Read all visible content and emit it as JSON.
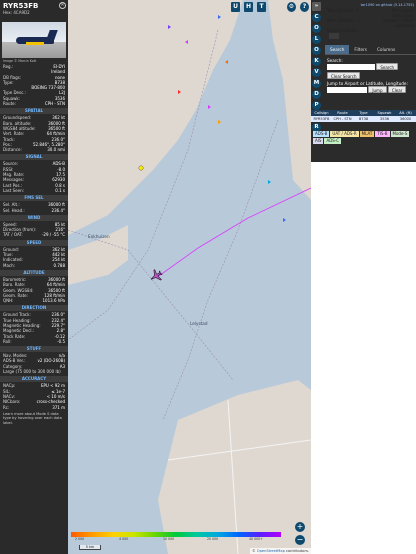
{
  "aircraft": {
    "callsign": "RYR53FB",
    "hex_line": "Hex: 4CA9D2",
    "photo_credit": "Image © Marcin Kott",
    "details": [
      {
        "k": "Reg.:",
        "v": "EI-DYI"
      },
      {
        "k": "",
        "v": "Ireland"
      },
      {
        "k": "DB flags:",
        "v": "none"
      },
      {
        "k": "Type:",
        "v": "B738"
      },
      {
        "k": "",
        "v": "BOEING 737-800"
      },
      {
        "k": "Type Desc.:",
        "v": "L2J"
      },
      {
        "k": "Squawk:",
        "v": "3536"
      },
      {
        "k": "Route:",
        "v": "CPH - STN"
      }
    ],
    "sections": [
      {
        "title": "SPATIAL",
        "rows": [
          {
            "k": "Groundspeed:",
            "v": "362 kt"
          },
          {
            "k": "Baro. altitude:",
            "v": "36000 ft"
          },
          {
            "k": "WGS84 altitude:",
            "v": "36500 ft"
          },
          {
            "k": "Vert. Rate:",
            "v": "64 ft/min"
          },
          {
            "k": "Track:",
            "v": "236.0°"
          },
          {
            "k": "Pos.:",
            "v": "52.846°, 5.280°"
          },
          {
            "k": "Distance:",
            "v": "30.0 nmi"
          }
        ]
      },
      {
        "title": "SIGNAL",
        "rows": [
          {
            "k": "Source:",
            "v": "ADS-B"
          },
          {
            "k": "RSSI:",
            "v": "-8.0"
          },
          {
            "k": "Msg. Rate:",
            "v": "17.5"
          },
          {
            "k": "Messages:",
            "v": "62930"
          },
          {
            "k": "Last Pos.:",
            "v": "0.8 s"
          },
          {
            "k": "Last Seen:",
            "v": "0.1 s"
          }
        ]
      },
      {
        "title": "FMS SEL",
        "rows": [
          {
            "k": "Sel. Alt.:",
            "v": "36000 ft"
          },
          {
            "k": "Sel. Head.:",
            "v": "236.4°"
          }
        ]
      },
      {
        "title": "WIND",
        "rows": [
          {
            "k": "Speed:",
            "v": "85 kt"
          },
          {
            "k": "Direction (from):",
            "v": "216°"
          },
          {
            "k": "TAT / OAT:",
            "v": "-29 / -55 °C"
          }
        ]
      },
      {
        "title": "SPEED",
        "rows": [
          {
            "k": "Ground:",
            "v": "362 kt"
          },
          {
            "k": "True:",
            "v": "442 kt"
          },
          {
            "k": "Indicated:",
            "v": "254 kt"
          },
          {
            "k": "Mach:",
            "v": "0.788"
          }
        ]
      },
      {
        "title": "ALTITUDE",
        "rows": [
          {
            "k": "Barometric:",
            "v": "36000 ft"
          },
          {
            "k": "Baro. Rate:",
            "v": "64 ft/min"
          },
          {
            "k": "Geom. WGS84:",
            "v": "36500 ft"
          },
          {
            "k": "Geom. Rate:",
            "v": "128 ft/min"
          },
          {
            "k": "QNH:",
            "v": "1013.6 hPa"
          }
        ]
      },
      {
        "title": "DIRECTION",
        "rows": [
          {
            "k": "Ground Track:",
            "v": "236.0°"
          },
          {
            "k": "True Heading:",
            "v": "232.4°"
          },
          {
            "k": "Magnetic Heading:",
            "v": "229.7°"
          },
          {
            "k": "Magnetic Decl.:",
            "v": "2.8°"
          },
          {
            "k": "Track Rate:",
            "v": "-0.12"
          },
          {
            "k": "Roll:",
            "v": "-0.5"
          }
        ]
      },
      {
        "title": "STUFF",
        "rows": [
          {
            "k": "Nav. Modes:",
            "v": "n/a"
          },
          {
            "k": "ADS-B Ver.:",
            "v": "v2 (DO-260B)"
          },
          {
            "k": "Category:",
            "v": "A3"
          },
          {
            "k": "Large (75 000 to 300 000 lb)",
            "v": ""
          }
        ]
      },
      {
        "title": "ACCURACY",
        "rows": [
          {
            "k": "NACp:",
            "v": "EPU < 92 m"
          },
          {
            "k": "SIL:",
            "v": "≤ 1e-7"
          },
          {
            "k": "NACv:",
            "v": "< 10 m/s"
          },
          {
            "k": "NICbaro:",
            "v": "cross-checked"
          },
          {
            "k": "Rc:",
            "v": "371 m"
          }
        ]
      }
    ],
    "help_note": "Learn more about Mode S data type by hovering over each data label."
  },
  "map": {
    "toolbar": [
      "U",
      "H",
      "T"
    ],
    "labels": [
      {
        "text": "Enkhuizen",
        "name": "enkhuizen-label"
      },
      {
        "text": "Lelystad",
        "name": "lelystad-label"
      }
    ],
    "altitude_legend": [
      "2 000",
      "4 000",
      "10 000",
      "20 000",
      "40 000+"
    ],
    "scale_label": "5 km",
    "attribution_prefix": "© ",
    "attribution_link": "OpenStreetMap",
    "attribution_suffix": " contributors.",
    "colors": {
      "water": "#b8c9d9",
      "land": "#ded8d0",
      "trail": "#d93cff",
      "aircraft": "#ffeb00"
    }
  },
  "sidebar": {
    "top_link": "tar1090 on github (3.14.1755)",
    "stats": {
      "total_label": "Total Aircraft: 1",
      "position_label": "With Position: 1",
      "messages_label": "Messages:",
      "messages_value": "1806.6/sec",
      "history_label": "History: 24620",
      "history_value": "positions",
      "stats_label": "Stats available"
    },
    "tabs": [
      "Search",
      "Filters",
      "Columns"
    ],
    "search_label": "Search:",
    "search_button": "Search",
    "clear_button": "Clear Search",
    "jump_label": "Jump to Airport or Latitude, Longitude:",
    "jump_button": "Jump",
    "jump_clear": "Clear",
    "table_headers": [
      "Callsign",
      "Route",
      "Type",
      "Squawk",
      "Alt. (ft)"
    ],
    "table_row": [
      "RYR53FB",
      "CPH - STN",
      "B738",
      "3536",
      "36000"
    ],
    "legend_chips": [
      {
        "text": "ADS-B",
        "color": "#b8e0ff"
      },
      {
        "text": "UAT / ADS-R",
        "color": "#f6e6a6"
      },
      {
        "text": "MLAT",
        "color": "#f0c06a"
      },
      {
        "text": "TIS-B",
        "color": "#ffb3ff"
      },
      {
        "text": "Mode-S",
        "color": "#cfe6cf"
      },
      {
        "text": "AIS",
        "color": "#d9d9f0"
      },
      {
        "text": "ADS-C",
        "color": "#c5f0c5"
      }
    ],
    "vtools": [
      "C",
      "O",
      "L",
      "O",
      "K",
      "V",
      "M",
      "D",
      "P",
      "I",
      "R"
    ]
  }
}
